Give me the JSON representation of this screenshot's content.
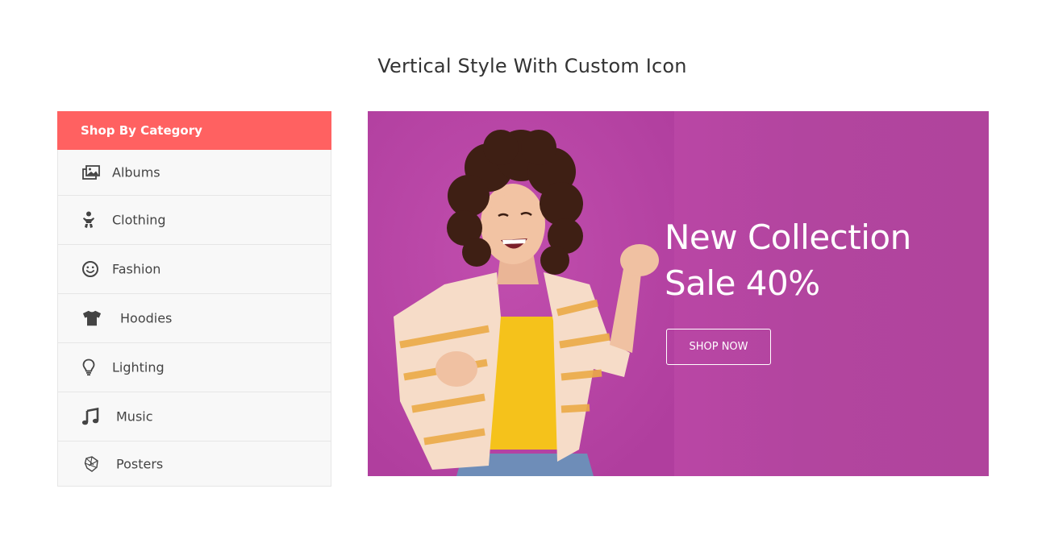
{
  "page": {
    "title": "Vertical Style With Custom Icon"
  },
  "category_menu": {
    "header": "Shop By Category",
    "items": [
      {
        "label": "Albums",
        "icon": "images-icon"
      },
      {
        "label": "Clothing",
        "icon": "baby-icon"
      },
      {
        "label": "Fashion",
        "icon": "smile-icon"
      },
      {
        "label": "Hoodies",
        "icon": "tshirt-icon"
      },
      {
        "label": "Lighting",
        "icon": "lightbulb-icon"
      },
      {
        "label": "Music",
        "icon": "music-note-icon"
      },
      {
        "label": "Posters",
        "icon": "paint-palette-icon"
      }
    ]
  },
  "banner": {
    "heading_line1": "New Collection",
    "heading_line2": "Sale 40%",
    "button_label": "SHOP NOW"
  },
  "colors": {
    "header_bg": "#ff6161",
    "banner_bg": "#b5449f",
    "menu_bg": "#f8f8f8"
  }
}
